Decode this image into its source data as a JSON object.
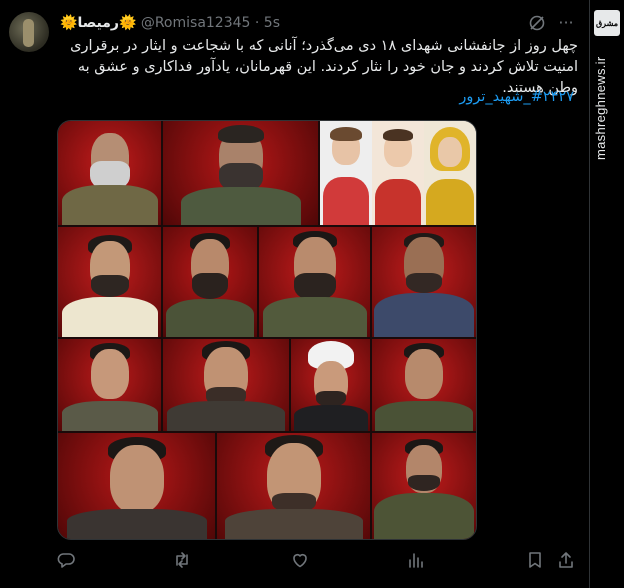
{
  "tweet": {
    "display_name": "رمیصا",
    "sun_emoji": "🌞",
    "handle": "@Romisa12345",
    "separator": "·",
    "time": "5s",
    "text": "چهل روز از جانفشانی شهدای ۱۸ دی می‌گذرد؛ آنانی که با شجاعت و ایثار در برقراری امنیت تلاش کردند و جان خود را نثار کردند. این قهرمانان، یادآور فداکاری و عشق به وطن هستند.",
    "hashtag": "#۲۴۲۷_شهید_ترور"
  },
  "watermark": {
    "logo_text": "مشرق",
    "site": "mashreghnews.ir"
  },
  "icons": {
    "reply": "reply-icon",
    "retweet": "retweet-icon",
    "like": "heart-icon",
    "views": "views-icon",
    "bookmark": "bookmark-icon",
    "share": "share-icon",
    "grok": "grok-icon",
    "more": "more-icon"
  },
  "colors": {
    "accent": "#1d9bf0",
    "muted": "#71767b",
    "background": "#000000"
  }
}
